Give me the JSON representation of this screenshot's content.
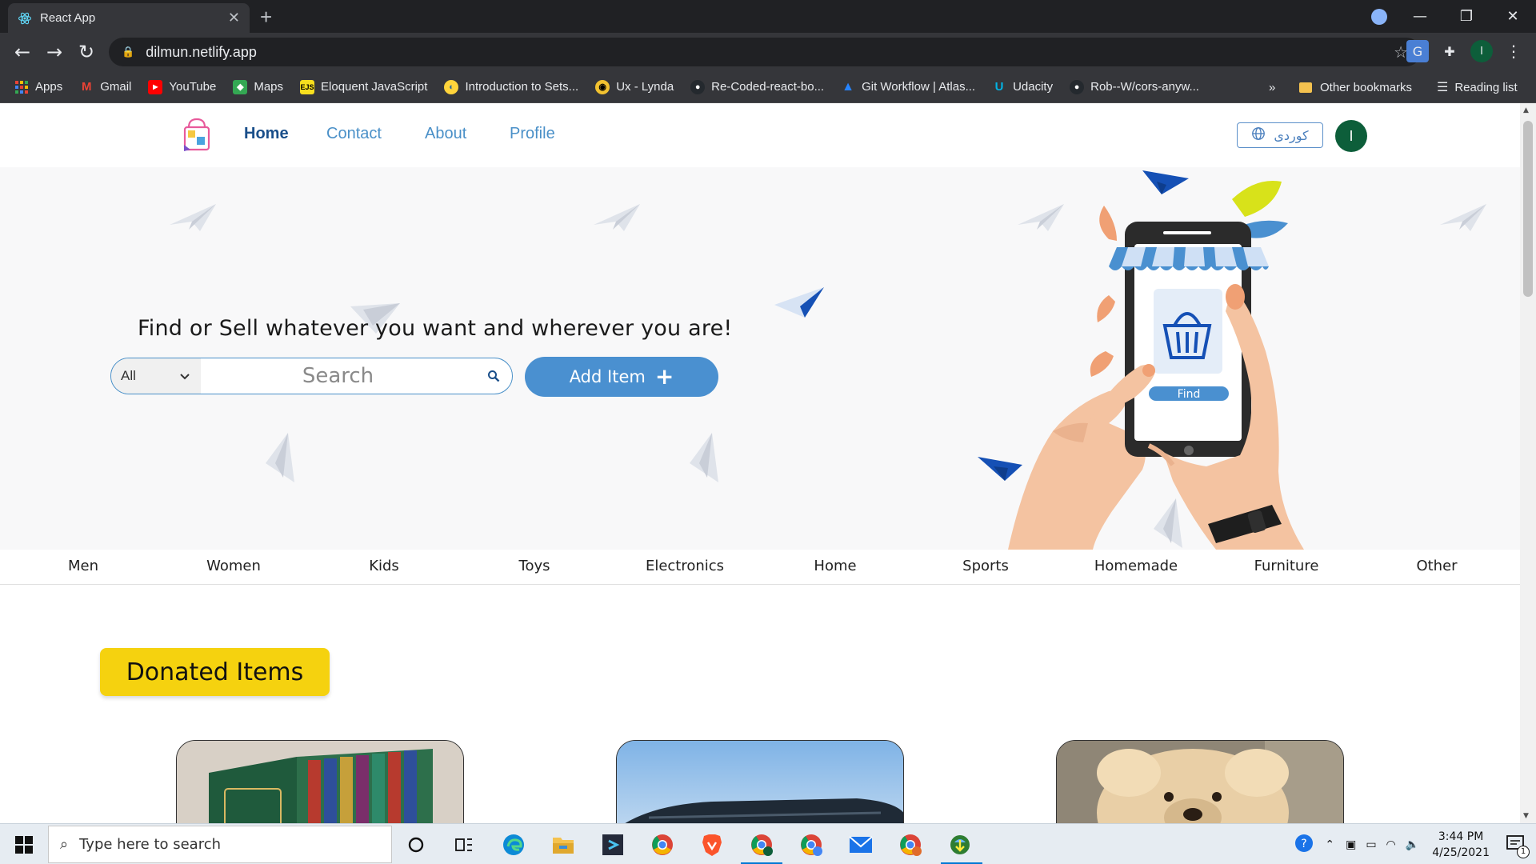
{
  "browser": {
    "tab_title": "React App",
    "tab_close": "✕",
    "new_tab": "+",
    "url": "dilmun.netlify.app",
    "profile_initial": "I",
    "window_controls": {
      "minimize": "—",
      "restore": "❐",
      "close": "✕"
    }
  },
  "bookmarks": {
    "items": [
      {
        "label": "Apps",
        "icon": "apps-grid-icon",
        "color": "#ea4335"
      },
      {
        "label": "Gmail",
        "icon": "gmail-icon",
        "color": "#ea4335"
      },
      {
        "label": "YouTube",
        "icon": "youtube-icon",
        "color": "#ff0000"
      },
      {
        "label": "Maps",
        "icon": "maps-icon",
        "color": "#34a853"
      },
      {
        "label": "Eloquent JavaScript",
        "icon": "eloquent-js-icon",
        "color": "#f7df1e"
      },
      {
        "label": "Introduction to Sets...",
        "icon": "python-icon",
        "color": "#ffd43b"
      },
      {
        "label": "Ux - Lynda",
        "icon": "lynda-icon",
        "color": "#f2c230"
      },
      {
        "label": "Re-Coded-react-bo...",
        "icon": "github-icon",
        "color": "#24292e"
      },
      {
        "label": "Git Workflow | Atlas...",
        "icon": "atlassian-icon",
        "color": "#2684ff"
      },
      {
        "label": "Udacity",
        "icon": "udacity-icon",
        "color": "#02b3e4"
      },
      {
        "label": "Rob--W/cors-anyw...",
        "icon": "github-icon",
        "color": "#24292e"
      }
    ],
    "overflow": "»",
    "other_bookmarks": "Other bookmarks",
    "reading_list": "Reading list"
  },
  "site": {
    "nav": {
      "home": "Home",
      "contact": "Contact",
      "about": "About",
      "profile": "Profile"
    },
    "language_button": "كوردی",
    "user_initial": "I",
    "hero": {
      "title": "Find or Sell whatever you want and wherever you are!",
      "search_category": "All",
      "search_placeholder": "Search",
      "add_item": "Add Item",
      "phone_button": "Find"
    },
    "categories": [
      "Men",
      "Women",
      "Kids",
      "Toys",
      "Electronics",
      "Home",
      "Sports",
      "Homemade",
      "Furniture",
      "Other"
    ],
    "section_title": "Donated Items"
  },
  "taskbar": {
    "search_placeholder": "Type here to search",
    "time": "3:44 PM",
    "date": "4/25/2021",
    "notification_count": "1"
  },
  "colors": {
    "accent": "#4a90d0",
    "nav_active": "#1a4f8a",
    "badge": "#f5d20f",
    "avatar": "#0d5e3a"
  }
}
